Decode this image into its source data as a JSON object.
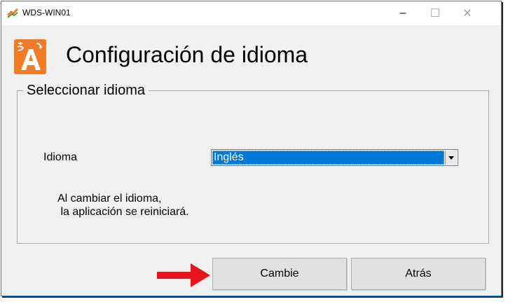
{
  "window": {
    "title": "WDS-WIN01",
    "controls": {
      "minimize": "–",
      "maximize": "☐",
      "close": "✕"
    }
  },
  "header": {
    "title": "Configuración de idioma",
    "icon": "language-icon"
  },
  "group": {
    "legend": "Seleccionar idioma",
    "language_label": "Idioma",
    "language_select": {
      "value": "Inglés"
    },
    "note": "Al cambiar el idioma,\n la aplicación se reiniciará."
  },
  "buttons": {
    "change": "Cambie",
    "back": "Atrás"
  },
  "colors": {
    "accent": "#0078d7",
    "icon_orange": "#f07b29",
    "annotation_arrow": "#e8141c"
  }
}
